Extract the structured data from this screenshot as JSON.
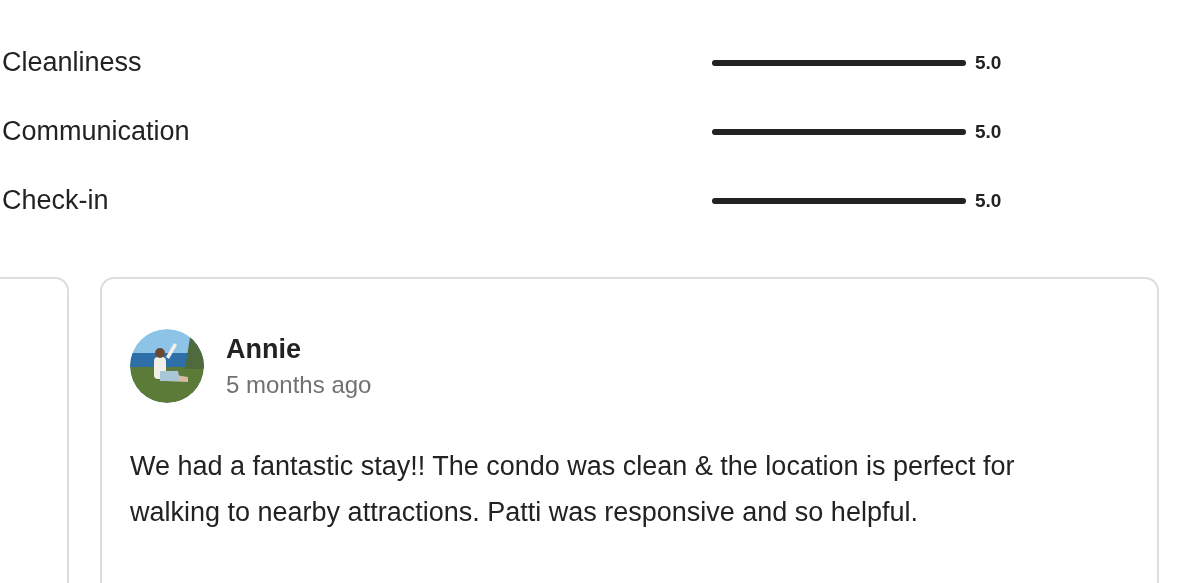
{
  "ratings": [
    {
      "label": "Cleanliness",
      "level": 1,
      "value": "5.0"
    },
    {
      "label": "Communication",
      "level": 1,
      "value": "5.0"
    },
    {
      "label": "Check-in",
      "level": 1,
      "value": "5.0"
    }
  ],
  "reviews": [
    {
      "author": "Annie",
      "date": "5 months ago",
      "text": "We had a fantastic stay!! The condo was clean & the location is perfect for walking to nearby attractions. Patti was responsive and so helpful."
    }
  ]
}
